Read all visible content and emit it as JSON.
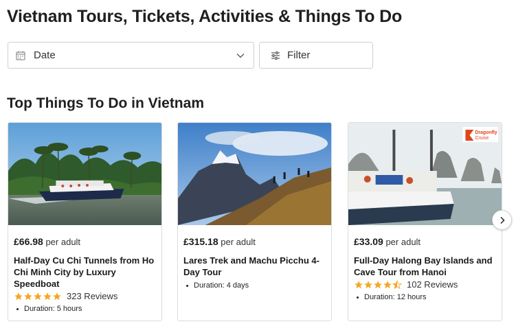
{
  "page_title": "Vietnam Tours, Tickets, Activities & Things To Do",
  "date_selector": {
    "label": "Date",
    "icon": "calendar-icon",
    "chevron": "chevron-down-icon"
  },
  "filter": {
    "label": "Filter",
    "icon": "sliders-icon"
  },
  "section_title": "Top Things To Do in Vietnam",
  "colors": {
    "star": "#f5a623",
    "border": "#cfcfcf"
  },
  "cards": [
    {
      "price": "£66.98",
      "price_unit": "per adult",
      "title": "Half-Day Cu Chi Tunnels from Ho Chi Minh City by Luxury Speedboat",
      "rating_stars": 5,
      "reviews": "323 Reviews",
      "duration": "Duration: 5 hours"
    },
    {
      "price": "£315.18",
      "price_unit": "per adult",
      "title": "Lares Trek and Machu Picchu 4-Day Tour",
      "duration": "Duration: 4 days"
    },
    {
      "price": "£33.09",
      "price_unit": "per adult",
      "title": "Full-Day Halong Bay Islands and Cave Tour from Hanoi",
      "rating_stars": 4.5,
      "reviews": "102 Reviews",
      "duration": "Duration: 12 hours",
      "image_logo": "Dragonfly Cruise"
    }
  ],
  "carousel": {
    "next_icon": "chevron-right-icon"
  }
}
